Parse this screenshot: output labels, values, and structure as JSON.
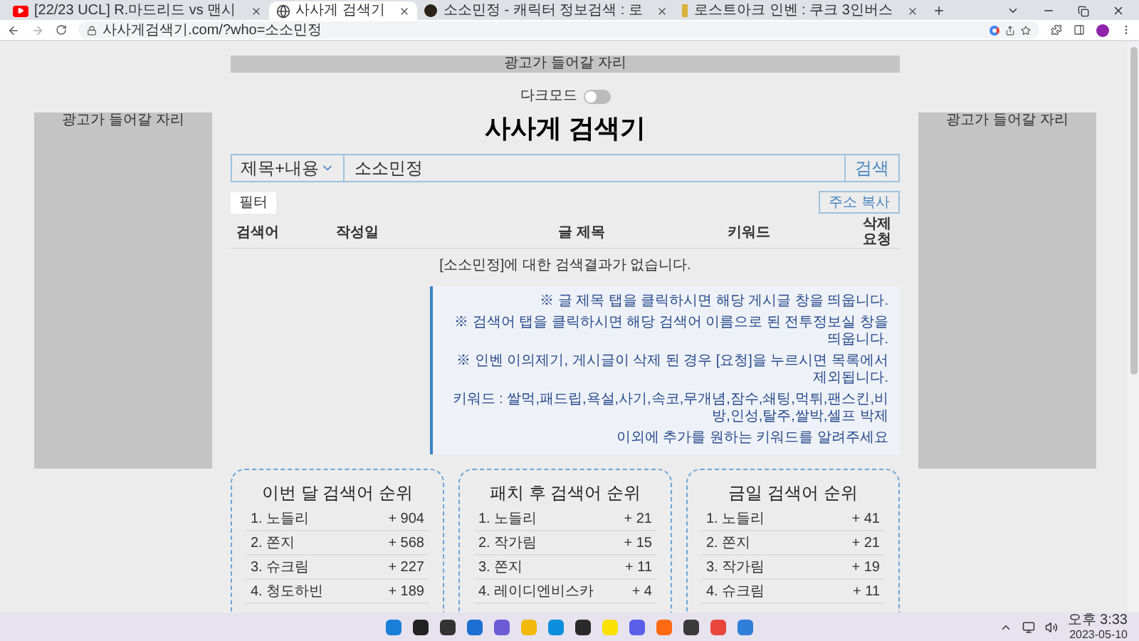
{
  "browser": {
    "tabs": [
      {
        "title": "[22/23 UCL] R.마드리드 vs 맨시",
        "selected": false,
        "kind": "video"
      },
      {
        "title": "사사게 검색기",
        "selected": true,
        "kind": "globe"
      },
      {
        "title": "소소민정 - 캐릭터 정보검색 : 로",
        "selected": false,
        "kind": "dark"
      },
      {
        "title": "로스트아크 인벤 : 쿠크 3인버스",
        "selected": false,
        "kind": "inven"
      }
    ],
    "url": "사사게검색기.com/?who=소소민정"
  },
  "ads": {
    "top": "광고가 들어갈 자리",
    "left": "광고가 들어갈 자리",
    "right": "광고가 들어갈 자리"
  },
  "dark_mode": {
    "label": "다크모드",
    "on": false
  },
  "title": "사사게 검색기",
  "search": {
    "scope": "제목+내용",
    "value": "소소민정",
    "button": "검색"
  },
  "filter_button": "필터",
  "copy_button": "주소 복사",
  "table": {
    "columns": [
      "검색어",
      "작성일",
      "글 제목",
      "키워드",
      "삭제 요청"
    ],
    "empty_message": "[소소민정]에 대한 검색결과가 없습니다."
  },
  "notice": [
    "※ 글 제목 탭을 클릭하시면 해당 게시글 창을 띄웁니다.",
    "※ 검색어 탭을 클릭하시면 해당 검색어 이름으로 된 전투정보실 창을 띄웁니다.",
    "※ 인벤 이의제기, 게시글이 삭제 된 경우 [요청]을 누르시면 목록에서 제외됩니다.",
    "키워드 : 쌀먹,패드립,욕설,사기,속코,무개념,잠수,쇄팅,먹튀,팬스킨,비방,인성,탈주,쌀박,셀프 박제",
    "이외에 추가를 원하는 키워드를 알려주세요"
  ],
  "rankings": [
    {
      "title": "이번 달 검색어 순위",
      "rows": [
        {
          "name": "1. 노들리",
          "count": "+ 904"
        },
        {
          "name": "2. 쫀지",
          "count": "+ 568"
        },
        {
          "name": "3. 슈크림",
          "count": "+ 227"
        },
        {
          "name": "4. 청도하빈",
          "count": "+ 189"
        }
      ]
    },
    {
      "title": "패치 후 검색어 순위",
      "rows": [
        {
          "name": "1. 노들리",
          "count": "+ 21"
        },
        {
          "name": "2. 작가림",
          "count": "+ 15"
        },
        {
          "name": "3. 쫀지",
          "count": "+ 11"
        },
        {
          "name": "4. 레이디엔비스카",
          "count": "+ 4"
        }
      ]
    },
    {
      "title": "금일 검색어 순위",
      "rows": [
        {
          "name": "1. 노들리",
          "count": "+ 41"
        },
        {
          "name": "2. 쫀지",
          "count": "+ 21"
        },
        {
          "name": "3. 작가림",
          "count": "+ 19"
        },
        {
          "name": "4. 슈크림",
          "count": "+ 11"
        }
      ]
    }
  ],
  "taskbar": {
    "time": "오후 3:33",
    "date": "2023-05-10"
  }
}
